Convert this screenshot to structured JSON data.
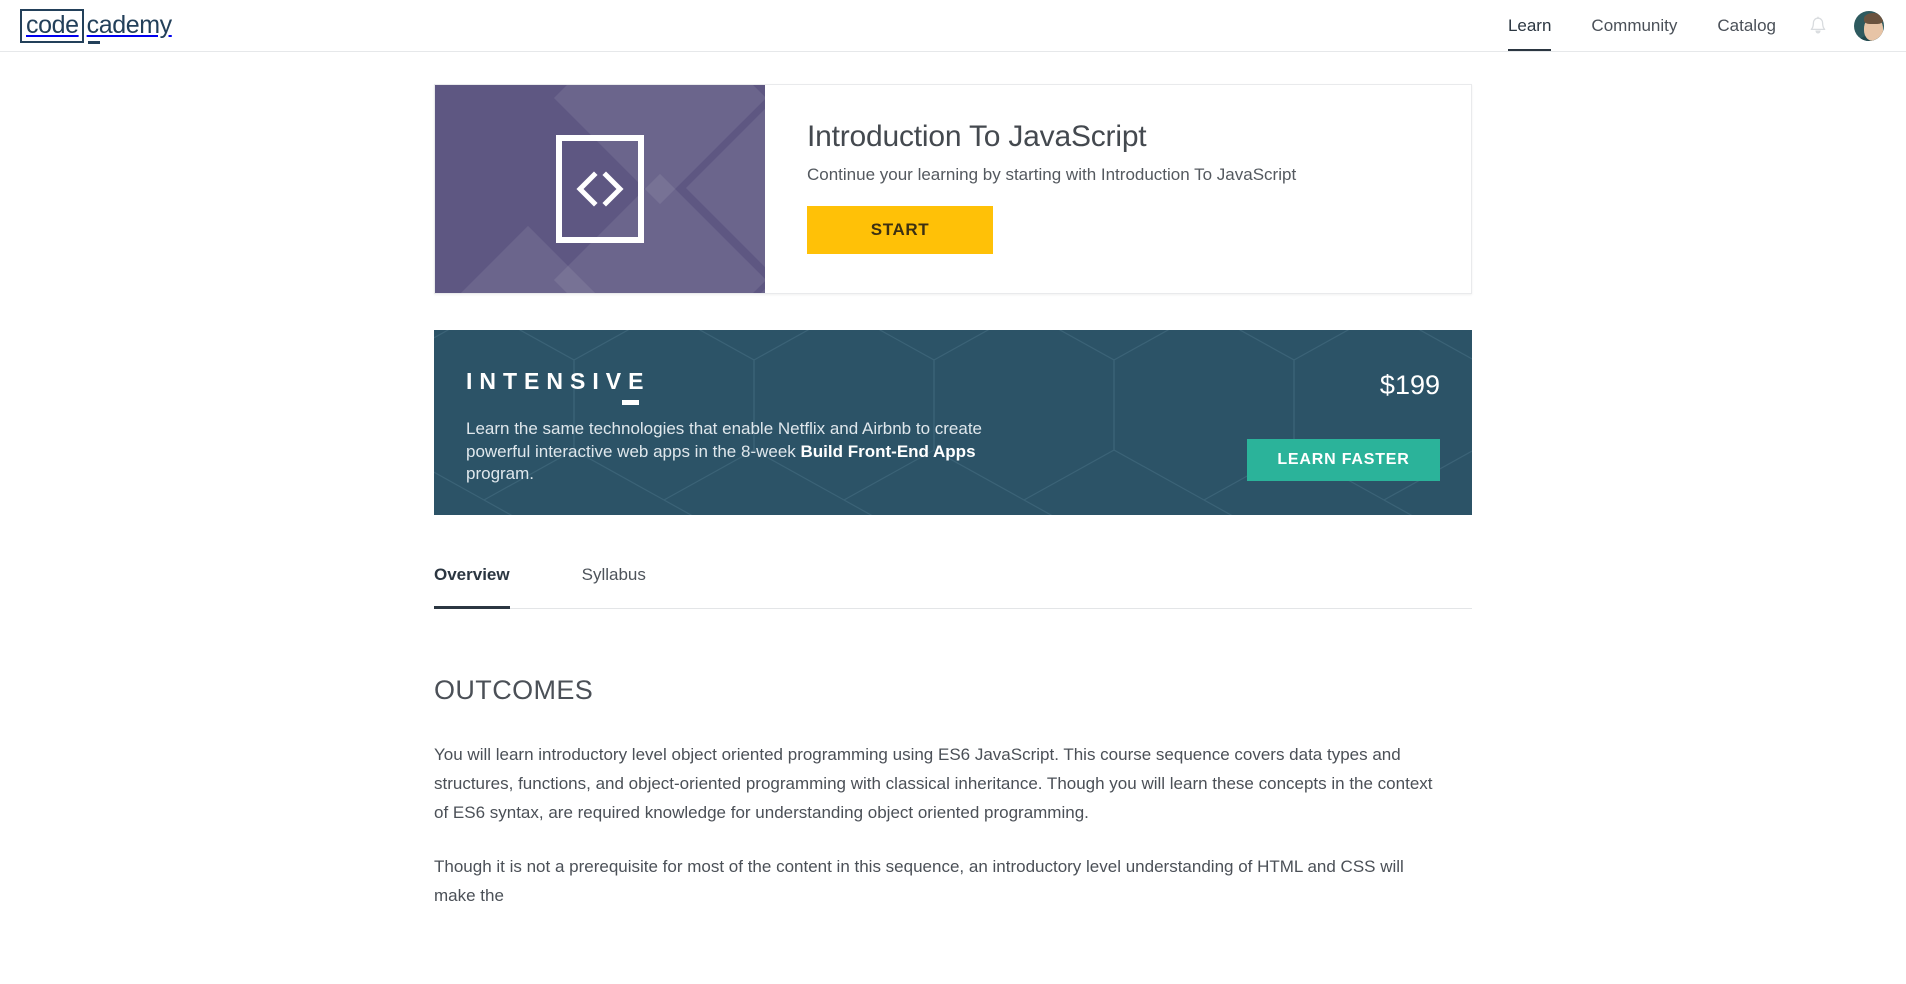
{
  "navbar": {
    "logo": {
      "boxed": "code",
      "rest": "cademy"
    },
    "links": [
      {
        "label": "Learn",
        "active": true
      },
      {
        "label": "Community",
        "active": false
      },
      {
        "label": "Catalog",
        "active": false
      }
    ],
    "bell_icon": "bell-icon",
    "avatar_label": "user-avatar"
  },
  "hero": {
    "thumbnail_icon": "code-brackets-icon",
    "title": "Introduction To JavaScript",
    "subtitle": "Continue your learning by starting with Introduction To JavaScript",
    "start_label": "START",
    "accent_color": "#ffc107",
    "thumb_color": "#5e5782"
  },
  "promo": {
    "kicker": "INTENSIVE",
    "text_part1": "Learn the same technologies that enable Netflix and Airbnb to create powerful interactive web apps in the 8-week ",
    "text_bold": "Build Front-End Apps",
    "text_part2": " program.",
    "price": "$199",
    "cta_label": "LEARN FASTER",
    "background_color": "#2c5367",
    "cta_color": "#2bb39a"
  },
  "tabs": [
    {
      "label": "Overview",
      "active": true
    },
    {
      "label": "Syllabus",
      "active": false
    }
  ],
  "outcomes": {
    "heading": "OUTCOMES",
    "paragraph1": "You will learn introductory level object oriented programming using ES6 JavaScript. This course sequence covers data types and structures, functions, and object-oriented programming with classical inheritance. Though you will learn these concepts in the context of ES6 syntax, are required knowledge for understanding object oriented programming.",
    "paragraph2": "Though it is not a prerequisite for most of the content in this sequence, an introductory level understanding of HTML and CSS will make the"
  }
}
